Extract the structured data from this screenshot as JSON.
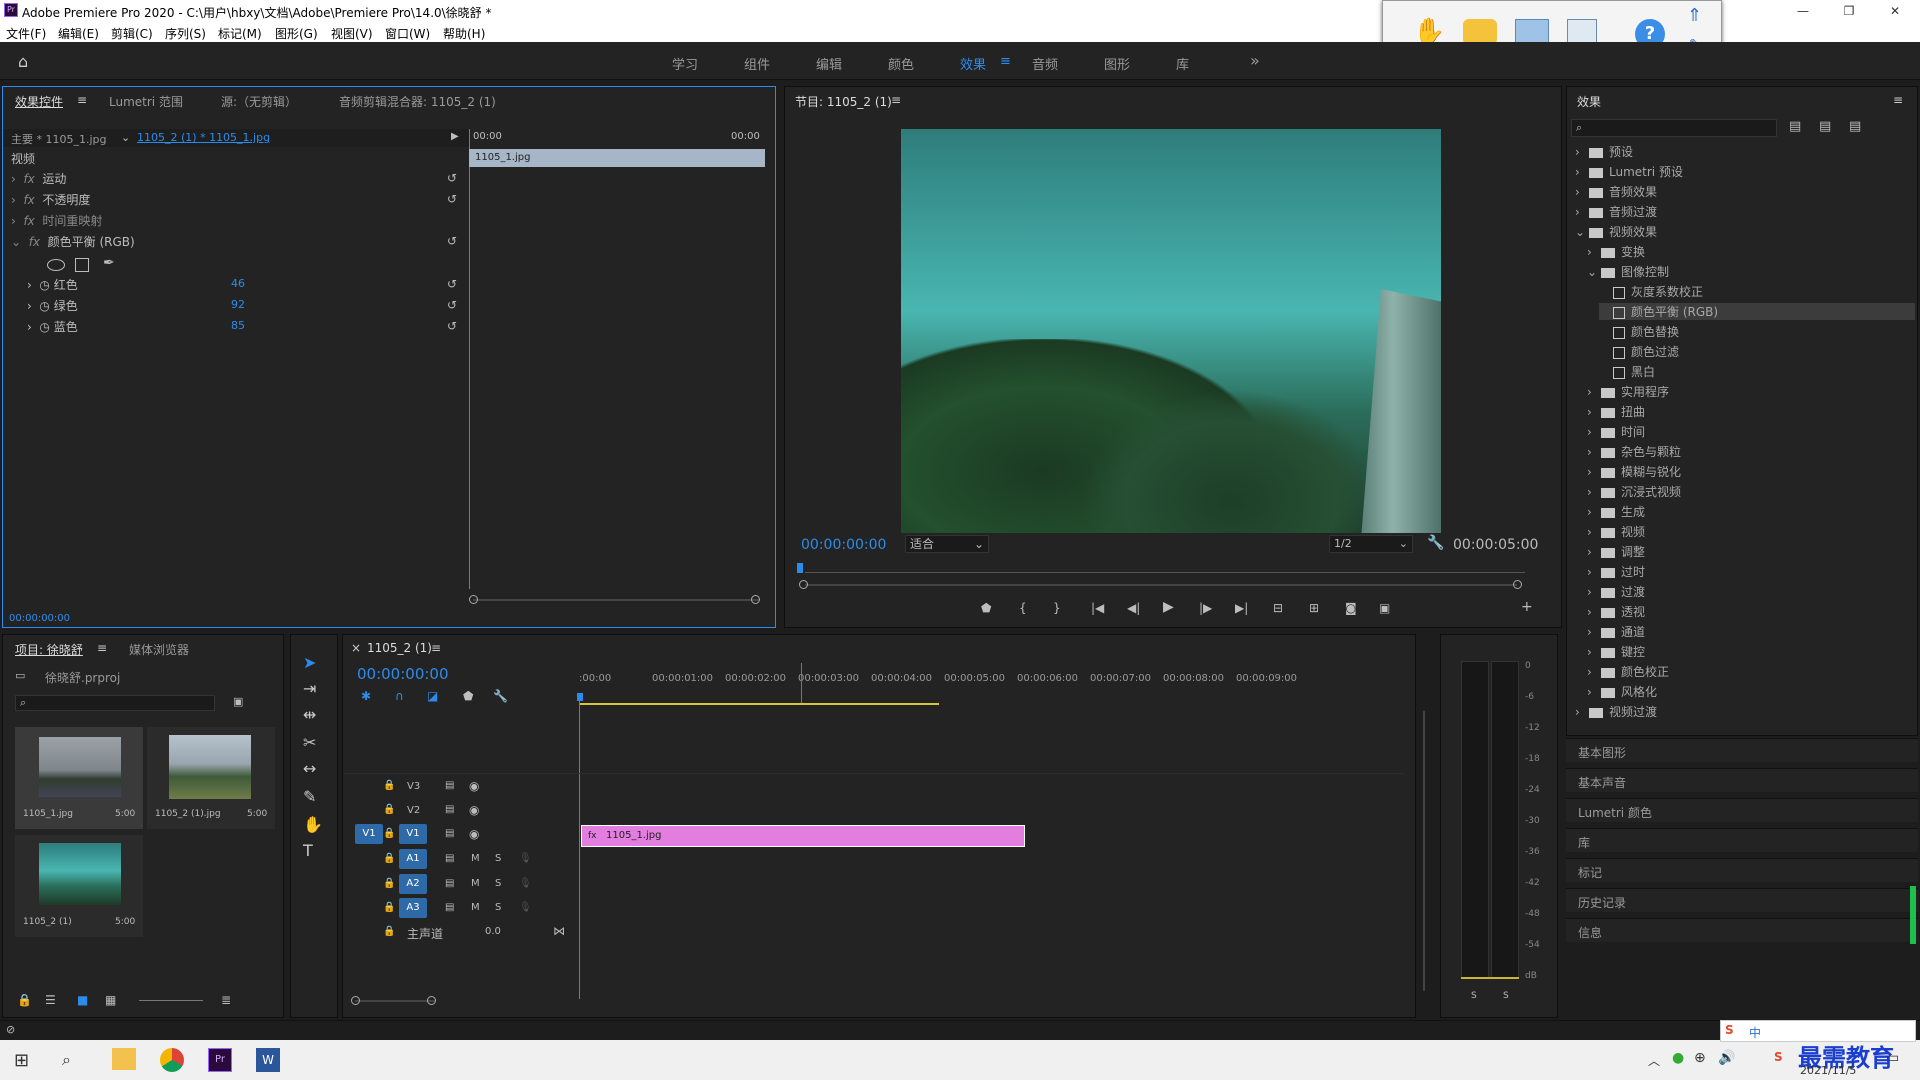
{
  "window": {
    "title": "Adobe Premiere Pro 2020 - C:\\用户\\hbxy\\文档\\Adobe\\Premiere Pro\\14.0\\徐晓舒 *",
    "logo": "Pr"
  },
  "menu": [
    "文件(F)",
    "编辑(E)",
    "剪辑(C)",
    "序列(S)",
    "标记(M)",
    "图形(G)",
    "视图(V)",
    "窗口(W)",
    "帮助(H)"
  ],
  "workspaces": [
    "学习",
    "组件",
    "编辑",
    "颜色",
    "效果",
    "音频",
    "图形",
    "库"
  ],
  "active_workspace": "效果",
  "effect_controls": {
    "tabs": [
      "效果控件",
      "Lumetri 范围",
      "源:（无剪辑）",
      "音频剪辑混合器: 1105_2 (1)"
    ],
    "master": "主要 * 1105_1.jpg",
    "clip": "1105_2 (1) * 1105_1.jpg",
    "time_start": "00:00",
    "time_end": "00:00",
    "clip_bar": "1105_1.jpg",
    "section": "视频",
    "effects": [
      "运动",
      "不透明度",
      "时间重映射",
      "颜色平衡 (RGB)"
    ],
    "params": [
      {
        "name": "红色",
        "value": "46"
      },
      {
        "name": "绿色",
        "value": "92"
      },
      {
        "name": "蓝色",
        "value": "85"
      }
    ],
    "timecode": "00:00:00:00"
  },
  "program": {
    "title": "节目: 1105_2 (1)",
    "timecode": "00:00:00:00",
    "fit": "适合",
    "res": "1/2",
    "duration": "00:00:05:00"
  },
  "effects_panel": {
    "title": "效果",
    "tree": [
      {
        "label": "预设",
        "level": 0,
        "icon": "folder"
      },
      {
        "label": "Lumetri 预设",
        "level": 0,
        "icon": "folder"
      },
      {
        "label": "音频效果",
        "level": 0,
        "icon": "folder"
      },
      {
        "label": "音频过渡",
        "level": 0,
        "icon": "folder"
      },
      {
        "label": "视频效果",
        "level": 0,
        "icon": "folder",
        "open": true
      },
      {
        "label": "变换",
        "level": 1,
        "icon": "folder"
      },
      {
        "label": "图像控制",
        "level": 1,
        "icon": "folder",
        "open": true
      },
      {
        "label": "灰度系数校正",
        "level": 2,
        "icon": "preset"
      },
      {
        "label": "颜色平衡 (RGB)",
        "level": 2,
        "icon": "preset",
        "selected": true
      },
      {
        "label": "颜色替换",
        "level": 2,
        "icon": "preset"
      },
      {
        "label": "颜色过滤",
        "level": 2,
        "icon": "preset"
      },
      {
        "label": "黑白",
        "level": 2,
        "icon": "preset"
      },
      {
        "label": "实用程序",
        "level": 1,
        "icon": "folder"
      },
      {
        "label": "扭曲",
        "level": 1,
        "icon": "folder"
      },
      {
        "label": "时间",
        "level": 1,
        "icon": "folder"
      },
      {
        "label": "杂色与颗粒",
        "level": 1,
        "icon": "folder"
      },
      {
        "label": "模糊与锐化",
        "level": 1,
        "icon": "folder"
      },
      {
        "label": "沉浸式视频",
        "level": 1,
        "icon": "folder"
      },
      {
        "label": "生成",
        "level": 1,
        "icon": "folder"
      },
      {
        "label": "视频",
        "level": 1,
        "icon": "folder"
      },
      {
        "label": "调整",
        "level": 1,
        "icon": "folder"
      },
      {
        "label": "过时",
        "level": 1,
        "icon": "folder"
      },
      {
        "label": "过渡",
        "level": 1,
        "icon": "folder"
      },
      {
        "label": "透视",
        "level": 1,
        "icon": "folder"
      },
      {
        "label": "通道",
        "level": 1,
        "icon": "folder"
      },
      {
        "label": "键控",
        "level": 1,
        "icon": "folder"
      },
      {
        "label": "颜色校正",
        "level": 1,
        "icon": "folder"
      },
      {
        "label": "风格化",
        "level": 1,
        "icon": "folder"
      },
      {
        "label": "视频过渡",
        "level": 0,
        "icon": "folder"
      }
    ],
    "side_panels": [
      "基本图形",
      "基本声音",
      "Lumetri 颜色",
      "库",
      "标记",
      "历史记录",
      "信息"
    ]
  },
  "project": {
    "tabs": [
      "项目: 徐晓舒",
      "媒体浏览器"
    ],
    "file": "徐晓舒.prproj",
    "items": [
      {
        "name": "1105_1.jpg",
        "dur": "5:00"
      },
      {
        "name": "1105_2 (1).jpg",
        "dur": "5:00"
      },
      {
        "name": "1105_2 (1)",
        "dur": "5:00"
      }
    ]
  },
  "timeline": {
    "tab": "1105_2 (1)",
    "timecode": "00:00:00:00",
    "ticks": [
      ":00:00",
      "00:00:01:00",
      "00:00:02:00",
      "00:00:03:00",
      "00:00:04:00",
      "00:00:05:00",
      "00:00:06:00",
      "00:00:07:00",
      "00:00:08:00",
      "00:00:09:00"
    ],
    "video_tracks": [
      "V3",
      "V2",
      "V1"
    ],
    "audio_tracks": [
      "A1",
      "A2",
      "A3"
    ],
    "master": "主声道",
    "master_val": "0.0",
    "clip": "1105_1.jpg",
    "src_v": "V1"
  },
  "meters": [
    "0",
    "-6",
    "-12",
    "-18",
    "-24",
    "-30",
    "-36",
    "-42",
    "-48",
    "-54",
    "dB"
  ],
  "meter_solo": [
    "S",
    "S"
  ],
  "taskbar": {
    "date": "2021/11/5",
    "watermark": "最需教育"
  },
  "colors": {
    "accent": "#2d8ceb",
    "clip": "#e17ee0",
    "bg": "#232323"
  }
}
